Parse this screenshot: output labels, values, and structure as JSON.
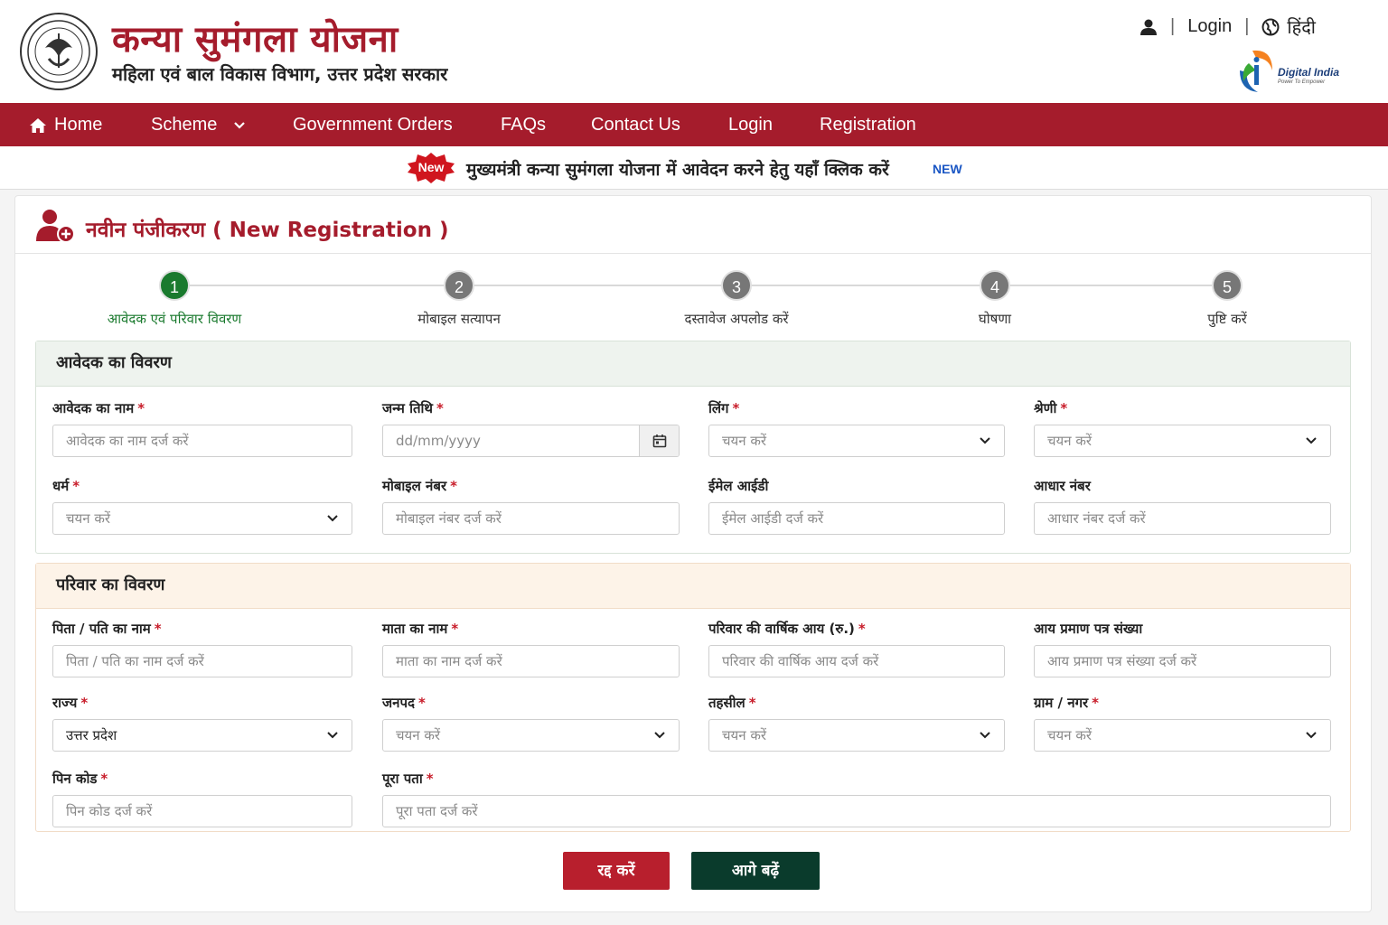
{
  "header": {
    "title": "कन्या सुमंगला योजना",
    "subtitle": "महिला एवं बाल विकास विभाग, उत्तर प्रदेश सरकार",
    "login_label": "Login",
    "language_label": "हिंदी",
    "digital_india_title": "Digital India",
    "digital_india_tagline": "Power To Empower"
  },
  "nav": {
    "home": "Home",
    "scheme": "Scheme",
    "government_orders": "Government Orders",
    "faqs": "FAQs",
    "contact_us": "Contact Us",
    "login": "Login",
    "registration": "Registration"
  },
  "ticker": {
    "badge": "New",
    "text": "मुख्यमंत्री कन्या सुमंगला योजना में आवेदन करने हेतु यहाँ क्लिक करें",
    "tag": "NEW"
  },
  "registration": {
    "title": "नवीन पंजीकरण ( New Registration )"
  },
  "steps": [
    {
      "number": "1",
      "label": "आवेदक एवं परिवार विवरण"
    },
    {
      "number": "2",
      "label": "मोबाइल सत्यापन"
    },
    {
      "number": "3",
      "label": "दस्तावेज अपलोड करें"
    },
    {
      "number": "4",
      "label": "घोषणा"
    },
    {
      "number": "5",
      "label": "पुष्टि करें"
    }
  ],
  "applicant": {
    "heading": "आवेदक का विवरण",
    "name": {
      "label": "आवेदक का नाम",
      "placeholder": "आवेदक का नाम दर्ज करें"
    },
    "dob": {
      "label": "जन्म तिथि",
      "placeholder": "dd/mm/yyyy"
    },
    "gender": {
      "label": "लिंग",
      "value": "चयन करें"
    },
    "category": {
      "label": "श्रेणी",
      "value": "चयन करें"
    },
    "religion": {
      "label": "धर्म",
      "value": "चयन करें"
    },
    "mobile": {
      "label": "मोबाइल नंबर",
      "placeholder": "मोबाइल नंबर दर्ज करें"
    },
    "email": {
      "label": "ईमेल आईडी",
      "placeholder": "ईमेल आईडी दर्ज करें"
    },
    "aadhaar": {
      "label": "आधार नंबर",
      "placeholder": "आधार नंबर दर्ज करें"
    }
  },
  "family": {
    "heading": "परिवार का विवरण",
    "father": {
      "label": "पिता / पति का नाम",
      "placeholder": "पिता / पति का नाम दर्ज करें"
    },
    "mother": {
      "label": "माता का नाम",
      "placeholder": "माता का नाम दर्ज करें"
    },
    "income": {
      "label": "परिवार की वार्षिक आय (रु.)",
      "placeholder": "परिवार की वार्षिक आय दर्ज करें"
    },
    "income_cert": {
      "label": "आय प्रमाण पत्र संख्या",
      "placeholder": "आय प्रमाण पत्र संख्या दर्ज करें"
    },
    "state": {
      "label": "राज्य",
      "value": "उत्तर प्रदेश"
    },
    "district": {
      "label": "जनपद",
      "value": "चयन करें"
    },
    "tehsil": {
      "label": "तहसील",
      "value": "चयन करें"
    },
    "village": {
      "label": "ग्राम / नगर",
      "value": "चयन करें"
    },
    "pincode": {
      "label": "पिन कोड",
      "placeholder": "पिन कोड दर्ज करें"
    },
    "address": {
      "label": "पूरा पता",
      "placeholder": "पूरा पता दर्ज करें"
    }
  },
  "actions": {
    "cancel": "रद्द करें",
    "next": "आगे बढ़ें"
  },
  "colors": {
    "brand": "#a51c2c",
    "active_step": "#1a7a2e",
    "next_button": "#0a3b2c",
    "cancel_button": "#b81f2d"
  }
}
